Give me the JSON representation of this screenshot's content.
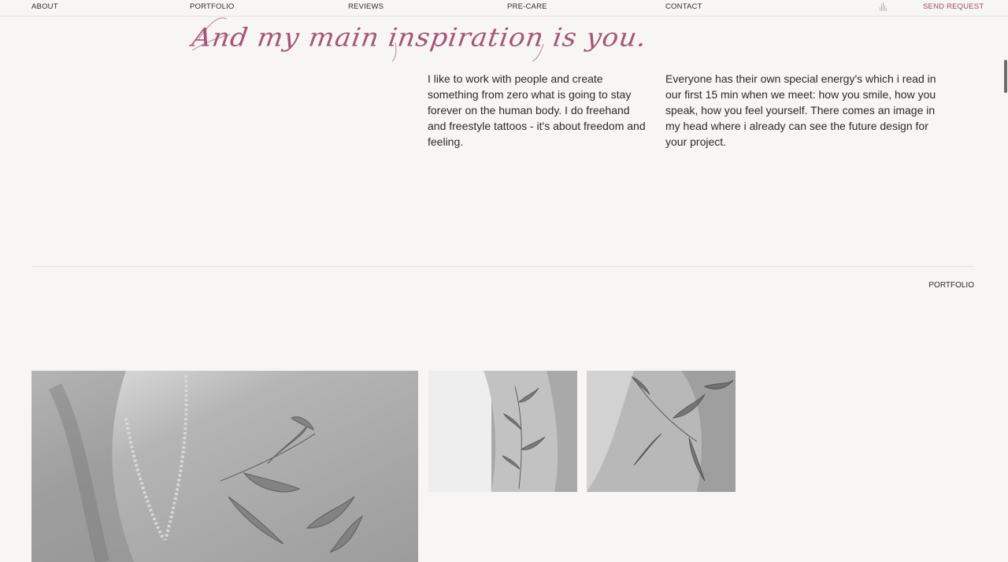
{
  "nav": {
    "about": "ABOUT",
    "portfolio": "PORTFOLIO",
    "reviews": "REVIEWS",
    "precare": "PRE-CARE",
    "contact": "CONTACT",
    "sound_icon": "sound-wave-icon",
    "send_request": "SEND REQUEST",
    "accent_color": "#9b4a6a"
  },
  "hero": {
    "script_heading": "And my main inspiration is you.",
    "paragraph_left": "I like to work with people and create something from zero what is going to stay forever on the human body. I do freehand and freestyle tattoos - it's about freedom and feeling.",
    "paragraph_right": "Everyone has their own special energy's which i read in our first 15 min when we meet: how you smile, how you speak, how you feel yourself. There comes an image in my head where i already can see the future design for your project."
  },
  "portfolio_section": {
    "label": "PORTFOLIO"
  }
}
